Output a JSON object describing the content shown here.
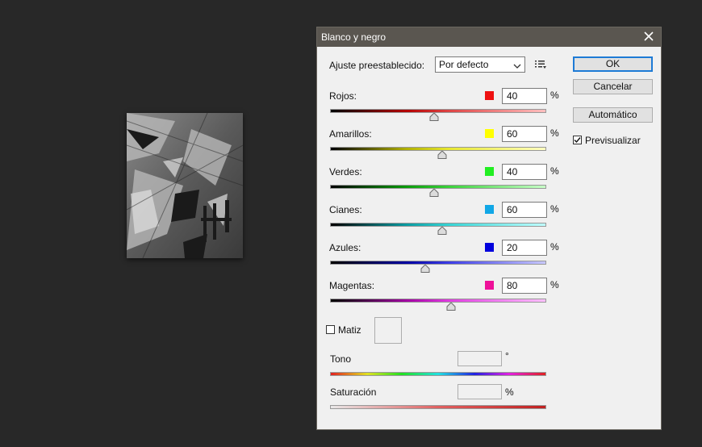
{
  "dialog": {
    "title": "Blanco y negro",
    "preset_label": "Ajuste preestablecido:",
    "preset_value": "Por defecto",
    "ok_label": "OK",
    "cancel_label": "Cancelar",
    "auto_label": "Automático",
    "preview_label": "Previsualizar",
    "preview_checked": true,
    "sliders": [
      {
        "key": "rojos",
        "label": "Rojos:",
        "value": "40",
        "min": -200,
        "max": 300,
        "color": "#ee1111",
        "gradient": "linear-gradient(to right,#000,#b30000 35%,#d44 55%,#ffc0c0)"
      },
      {
        "key": "amarillos",
        "label": "Amarillos:",
        "value": "60",
        "min": -200,
        "max": 300,
        "color": "#ffff00",
        "gradient": "linear-gradient(to right,#000,#b0b000 35%,#e8e830 55%,#ffffc0)"
      },
      {
        "key": "verdes",
        "label": "Verdes:",
        "value": "40",
        "min": -200,
        "max": 300,
        "color": "#22ee22",
        "gradient": "linear-gradient(to right,#000,#0a9a0a 35%,#3ad23a 55%,#c8ffc8)"
      },
      {
        "key": "cianes",
        "label": "Cianes:",
        "value": "60",
        "min": -200,
        "max": 300,
        "color": "#11a7e6",
        "gradient": "linear-gradient(to right,#000,#0a9aa0 35%,#37d4d4 55%,#c0ffff)"
      },
      {
        "key": "azules",
        "label": "Azules:",
        "value": "20",
        "min": -200,
        "max": 300,
        "color": "#0000dd",
        "gradient": "linear-gradient(to right,#000,#0000a0 35%,#3c3ce6 55%,#c8c8ff)"
      },
      {
        "key": "magentas",
        "label": "Magentas:",
        "value": "80",
        "min": -200,
        "max": 300,
        "color": "#ee1199",
        "gradient": "linear-gradient(to right,#000,#a000a0 35%,#e03ce0 55%,#ffc0ff)"
      }
    ],
    "matiz_label": "Matiz",
    "matiz_checked": false,
    "tono_label": "Tono",
    "tono_unit": "°",
    "saturacion_label": "Saturación",
    "saturacion_unit": "%",
    "percent_sign": "%"
  },
  "icons": {
    "close": "close-icon",
    "chevron": "chevron-down-icon",
    "menu": "preset-options-icon"
  }
}
